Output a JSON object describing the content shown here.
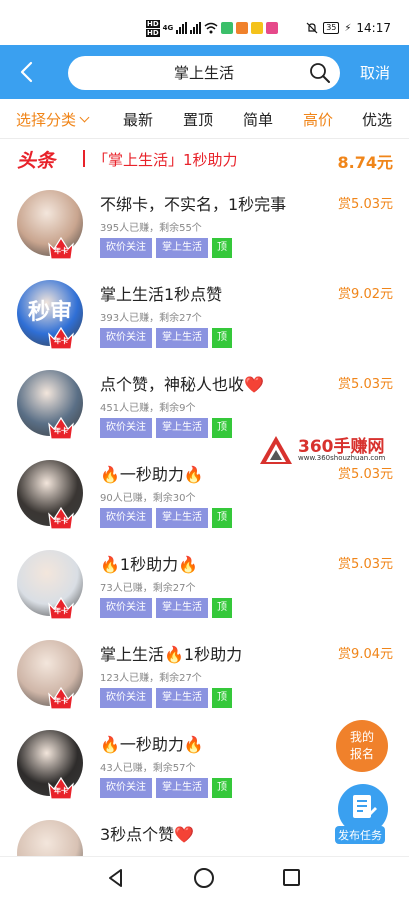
{
  "status_bar": {
    "hd1": "HD",
    "hd2": "HD",
    "net": "4G",
    "battery": "35",
    "time": "14:17"
  },
  "header": {
    "search_value": "掌上生活",
    "cancel_label": "取消"
  },
  "tabs": [
    {
      "label": "选择分类",
      "active": true
    },
    {
      "label": "最新",
      "active": false
    },
    {
      "label": "置顶",
      "active": false
    },
    {
      "label": "简单",
      "active": false
    },
    {
      "label": "高价",
      "active": true
    },
    {
      "label": "优选",
      "active": false
    }
  ],
  "headline": {
    "tag": "头条",
    "title": "「掌上生活」1秒助力",
    "price": "8.74元"
  },
  "badge_label": "年卡",
  "tag_labels": {
    "follow": "砍价关注",
    "app": "掌上生活",
    "top": "顶"
  },
  "tasks": [
    {
      "title": "不绑卡，不实名，1秒完事",
      "price": "赏5.03元",
      "stats": "395人已赚，剩余55个",
      "avatar_color": "#c9a58f"
    },
    {
      "title": "掌上生活1秒点赞",
      "price": "赏9.02元",
      "stats": "393人已赚，剩余27个",
      "avatar_color": "#2f6fd6"
    },
    {
      "title": "点个赞，神秘人也收❤️",
      "price": "赏5.03元",
      "stats": "451人已赚，剩余9个",
      "avatar_color": "#5a6f86"
    },
    {
      "title": "🔥一秒助力🔥",
      "price": "赏5.03元",
      "stats": "90人已赚，剩余30个",
      "avatar_color": "#3a3633"
    },
    {
      "title": "🔥1秒助力🔥",
      "price": "赏5.03元",
      "stats": "73人已赚，剩余27个",
      "avatar_color": "#d9dee4"
    },
    {
      "title": "掌上生活🔥1秒助力",
      "price": "赏9.04元",
      "stats": "123人已赚，剩余27个",
      "avatar_color": "#cfb6a8"
    },
    {
      "title": "🔥一秒助力🔥",
      "price": "",
      "stats": "43人已赚，剩余57个",
      "avatar_color": "#2e2c2b"
    },
    {
      "title": "3秒点个赞❤️",
      "price": "",
      "stats": "",
      "avatar_color": "#d8c2b4"
    }
  ],
  "watermark": {
    "title": "360手赚网",
    "url": "www.360shouzhuan.com"
  },
  "fab": {
    "report_line1": "我的",
    "report_line2": "报名",
    "publish_label": "发布任务"
  },
  "colors": {
    "primary": "#3aa0f0",
    "accent": "#f08519",
    "headline_red": "#e8222a",
    "tag_purple": "#8b93e0",
    "tag_green": "#35c83a"
  }
}
